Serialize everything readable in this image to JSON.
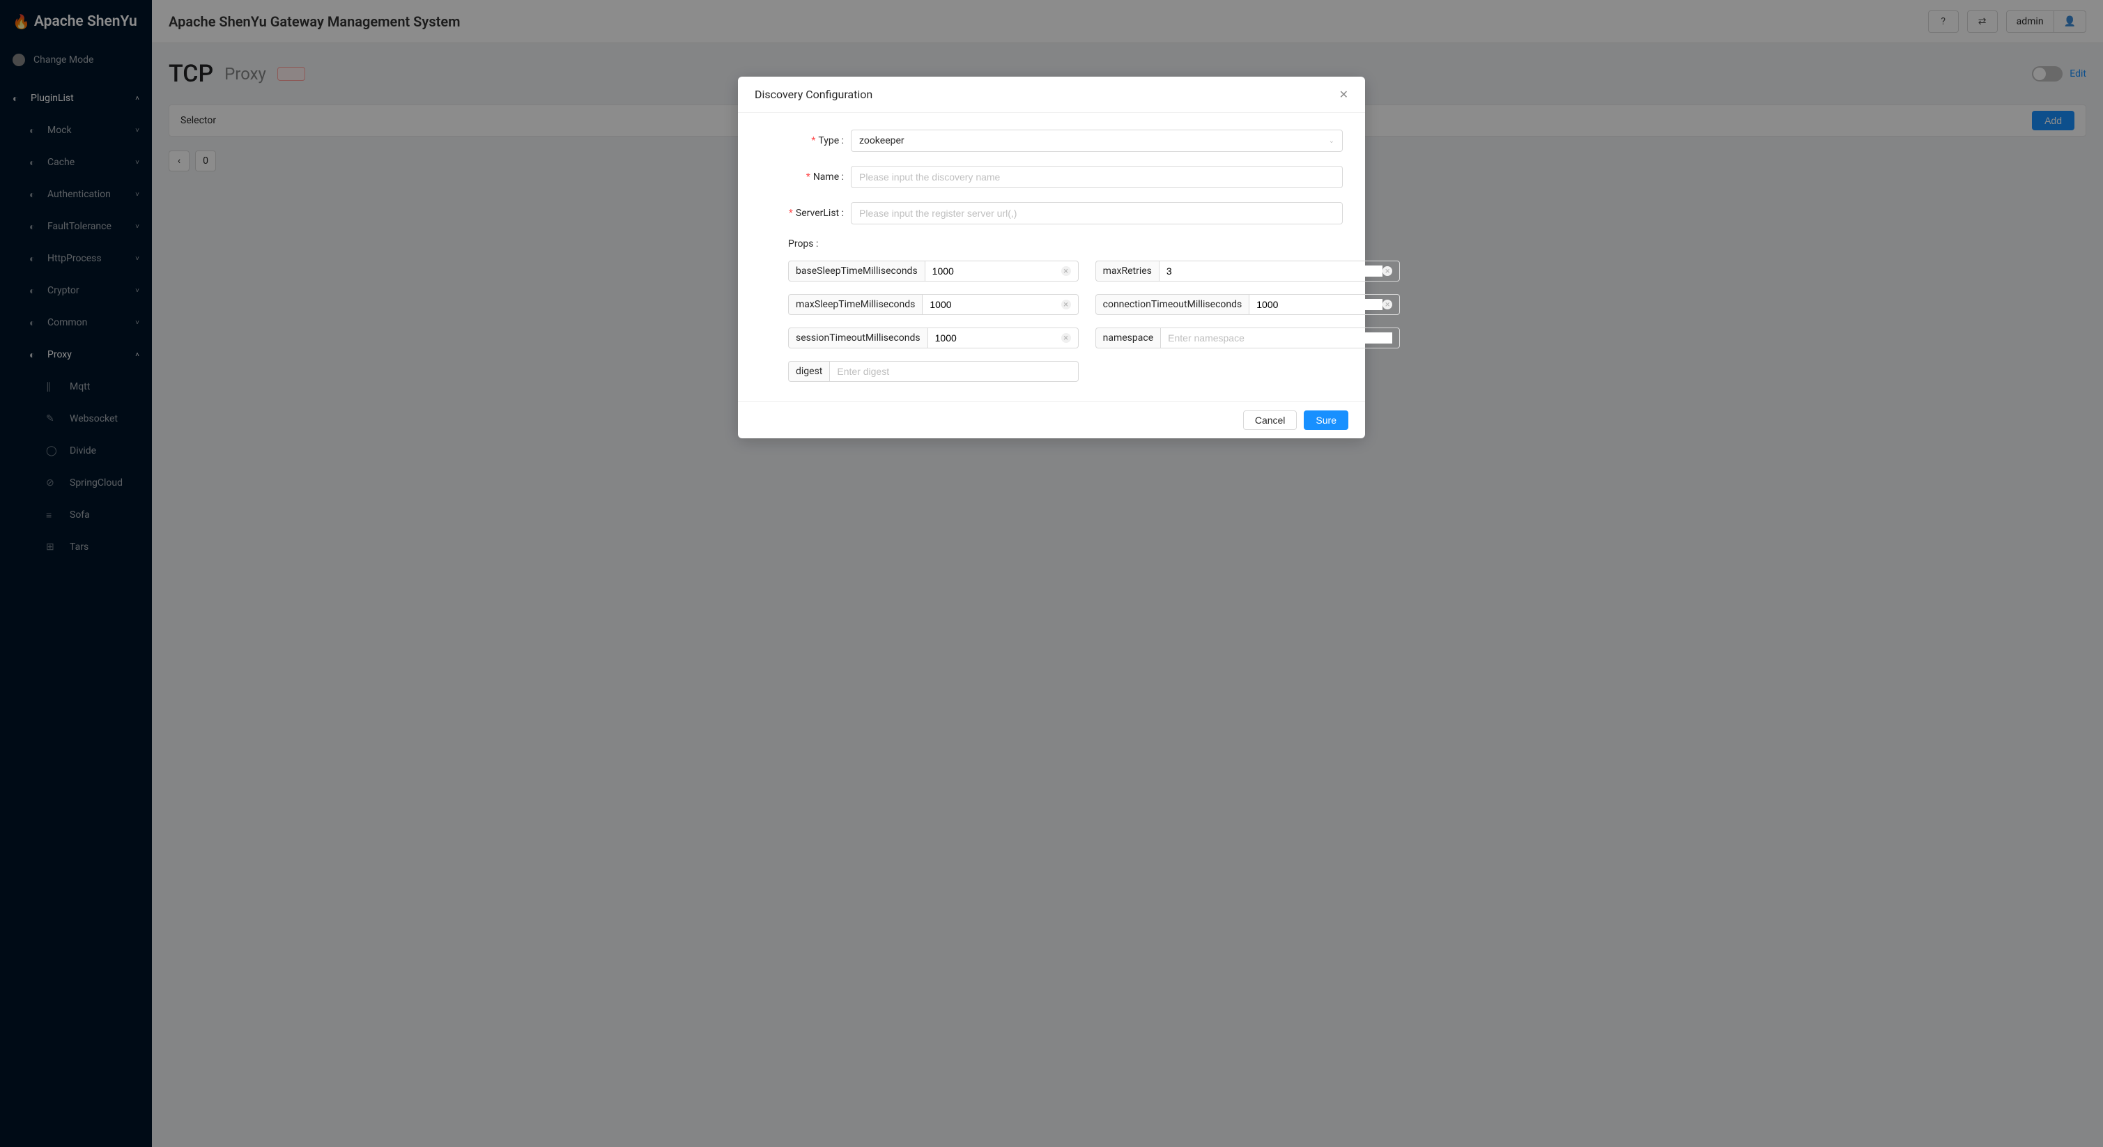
{
  "brand": {
    "name": "Apache ShenYu"
  },
  "header": {
    "title": "Apache ShenYu Gateway Management System",
    "user": "admin"
  },
  "sidebar": {
    "mode_label": "Change Mode",
    "plugin_list": "PluginList",
    "groups": [
      {
        "label": "Mock"
      },
      {
        "label": "Cache"
      },
      {
        "label": "Authentication"
      },
      {
        "label": "FaultTolerance"
      },
      {
        "label": "HttpProcess"
      },
      {
        "label": "Cryptor"
      },
      {
        "label": "Common"
      }
    ],
    "proxy_label": "Proxy",
    "proxy_items": [
      {
        "label": "Mqtt",
        "icon": "∥"
      },
      {
        "label": "Websocket",
        "icon": "✎"
      },
      {
        "label": "Divide",
        "icon": "◯"
      },
      {
        "label": "SpringCloud",
        "icon": "⊘"
      },
      {
        "label": "Sofa",
        "icon": "≡"
      },
      {
        "label": "Tars",
        "icon": "⊞"
      }
    ]
  },
  "page": {
    "title": "TCP",
    "subtitle": "Proxy",
    "status": "",
    "edit": "Edit",
    "selector": "Selector",
    "add": "Add",
    "pager": "0"
  },
  "modal": {
    "title": "Discovery Configuration",
    "type_label": "Type",
    "type_value": "zookeeper",
    "name_label": "Name",
    "name_placeholder": "Please input the discovery name",
    "serverlist_label": "ServerList",
    "serverlist_placeholder": "Please input the register server url(,)",
    "props_label": "Props",
    "props": [
      {
        "key": "baseSleepTimeMilliseconds",
        "value": "1000",
        "placeholder": "",
        "clearable": true
      },
      {
        "key": "maxRetries",
        "value": "3",
        "placeholder": "",
        "clearable": true
      },
      {
        "key": "maxSleepTimeMilliseconds",
        "value": "1000",
        "placeholder": "",
        "clearable": true
      },
      {
        "key": "connectionTimeoutMilliseconds",
        "value": "1000",
        "placeholder": "",
        "clearable": true
      },
      {
        "key": "sessionTimeoutMilliseconds",
        "value": "1000",
        "placeholder": "",
        "clearable": true
      },
      {
        "key": "namespace",
        "value": "",
        "placeholder": "Enter namespace",
        "clearable": false
      },
      {
        "key": "digest",
        "value": "",
        "placeholder": "Enter digest",
        "clearable": false
      }
    ],
    "cancel": "Cancel",
    "sure": "Sure"
  }
}
